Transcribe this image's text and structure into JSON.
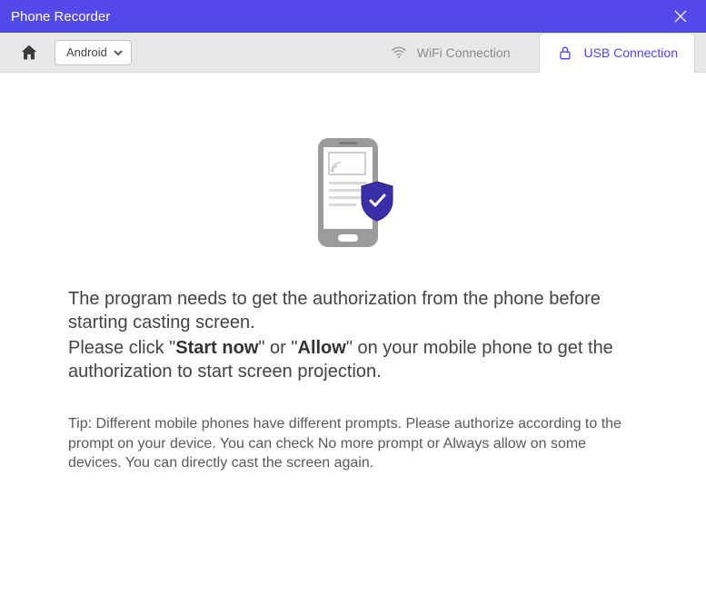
{
  "title": "Phone Recorder",
  "platform_selector": {
    "selected": "Android"
  },
  "tabs": {
    "wifi": {
      "label": "WiFi Connection"
    },
    "usb": {
      "label": "USB Connection"
    }
  },
  "message": {
    "line1": "The program needs to get the authorization from the phone before starting casting screen.",
    "line2_a": "Please click \"",
    "line2_bold1": "Start now",
    "line2_b": "\" or \"",
    "line2_bold2": "Allow",
    "line2_c": "\" on your mobile phone to get the authorization to start screen projection."
  },
  "tip": "Tip: Different mobile phones have different prompts. Please authorize according to the prompt on your device. You can check No more prompt or Always allow on some devices. You can directly cast the screen again.",
  "icons": {
    "close": "close-icon",
    "home": "home-icon",
    "chevron": "chevron-down-icon",
    "wifi": "wifi-icon",
    "lock": "lock-icon",
    "phone": "phone-shield-icon"
  }
}
